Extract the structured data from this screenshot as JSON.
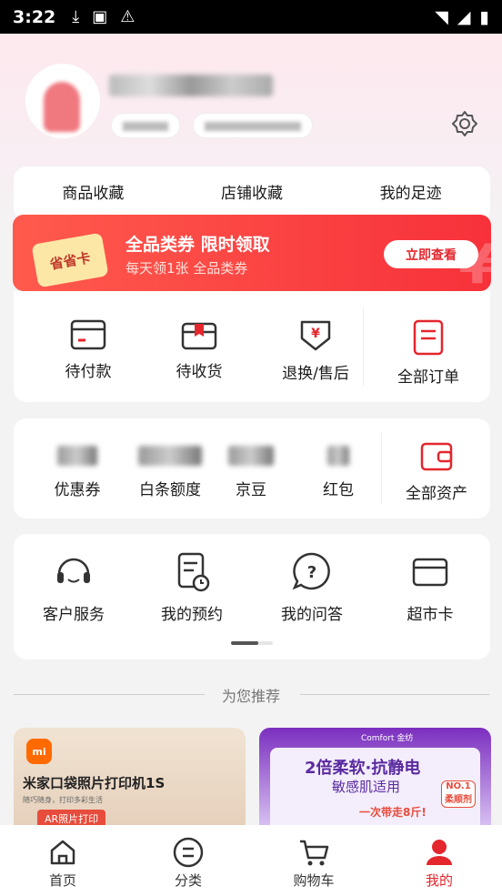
{
  "status_bar": {
    "time": "3:22"
  },
  "tabs": [
    "商品收藏",
    "店铺收藏",
    "我的足迹"
  ],
  "banner": {
    "tag": "省省卡",
    "title": "全品类券 限时领取",
    "subtitle": "每天领1张 全品类券",
    "button": "立即查看"
  },
  "orders": [
    {
      "label": "待付款",
      "icon": "wallet-card-icon"
    },
    {
      "label": "待收货",
      "icon": "package-icon"
    },
    {
      "label": "退换/售后",
      "icon": "refund-icon"
    },
    {
      "label": "全部订单",
      "icon": "order-list-icon"
    }
  ],
  "assets": [
    {
      "label": "优惠券"
    },
    {
      "label": "白条额度"
    },
    {
      "label": "京豆"
    },
    {
      "label": "红包"
    },
    {
      "label": "全部资产",
      "icon": "wallet-icon"
    }
  ],
  "services": [
    {
      "label": "客户服务",
      "icon": "headset-icon"
    },
    {
      "label": "我的预约",
      "icon": "appointment-icon"
    },
    {
      "label": "我的问答",
      "icon": "question-icon"
    },
    {
      "label": "超市卡",
      "icon": "card-icon"
    }
  ],
  "recommend_title": "为您推荐",
  "products": [
    {
      "brand_badge": "mi",
      "name": "米家口袋照片打印机1S",
      "tagline": "随巧随身，打印多彩生活",
      "tag": "AR照片打印"
    },
    {
      "brand": "Comfort 金纺",
      "headline": "2倍柔软·抗静电",
      "sub": "敏感肌适用",
      "badge": "NO.1 柔顺剂",
      "promo": "一次带走8斤!"
    }
  ],
  "bottom_nav": [
    {
      "label": "首页",
      "icon": "home-icon"
    },
    {
      "label": "分类",
      "icon": "category-icon"
    },
    {
      "label": "购物车",
      "icon": "cart-icon"
    },
    {
      "label": "我的",
      "icon": "profile-icon",
      "active": true
    }
  ],
  "colors": {
    "accent": "#e4262d",
    "banner_start": "#ff5a4d",
    "banner_end": "#f7313a"
  }
}
